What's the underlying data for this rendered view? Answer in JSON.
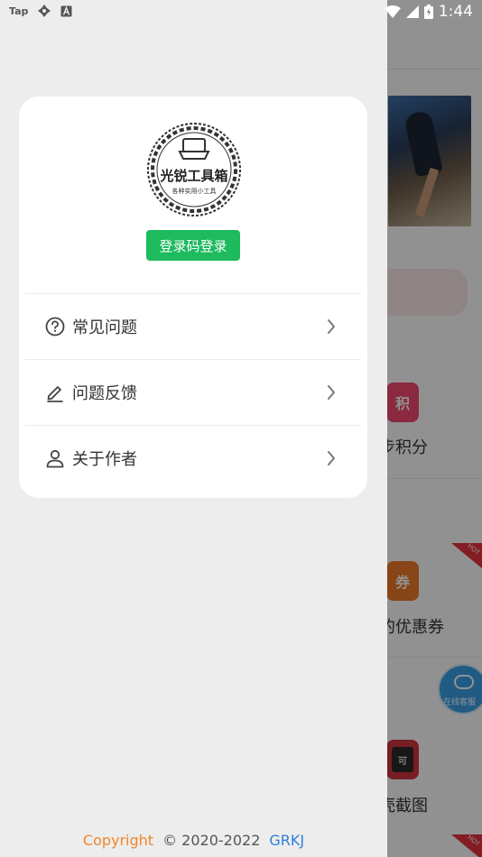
{
  "status_bar": {
    "left_label": "Tap",
    "time": "1:44",
    "icons": [
      "pinwheel-icon",
      "a-icon",
      "wifi-icon",
      "signal-icon",
      "battery-icon"
    ]
  },
  "background_app": {
    "items": [
      {
        "label": "步积分",
        "tile_text": "积"
      },
      {
        "label": "的优惠券",
        "tile_text": "券",
        "badge": "HOT"
      },
      {
        "label": "壳截图",
        "tile_text": "可",
        "badge": "HOT"
      }
    ],
    "service_label": "在线客服"
  },
  "drawer": {
    "logo": {
      "title": "光锐工具箱",
      "subtitle": "各种实用小工具"
    },
    "login_button": "登录码登录",
    "menu": [
      {
        "label": "常见问题",
        "icon": "question-circle-icon"
      },
      {
        "label": "问题反馈",
        "icon": "pencil-icon"
      },
      {
        "label": "关于作者",
        "icon": "person-icon"
      }
    ],
    "footer": {
      "copyright_word": "Copyright",
      "years": "© 2020-2022",
      "company": "GRKJ"
    }
  },
  "colors": {
    "accent_green": "#1dba5e",
    "drawer_bg": "#ededed",
    "footer_copyright": "#f0872a",
    "footer_company": "#2f80d8"
  }
}
